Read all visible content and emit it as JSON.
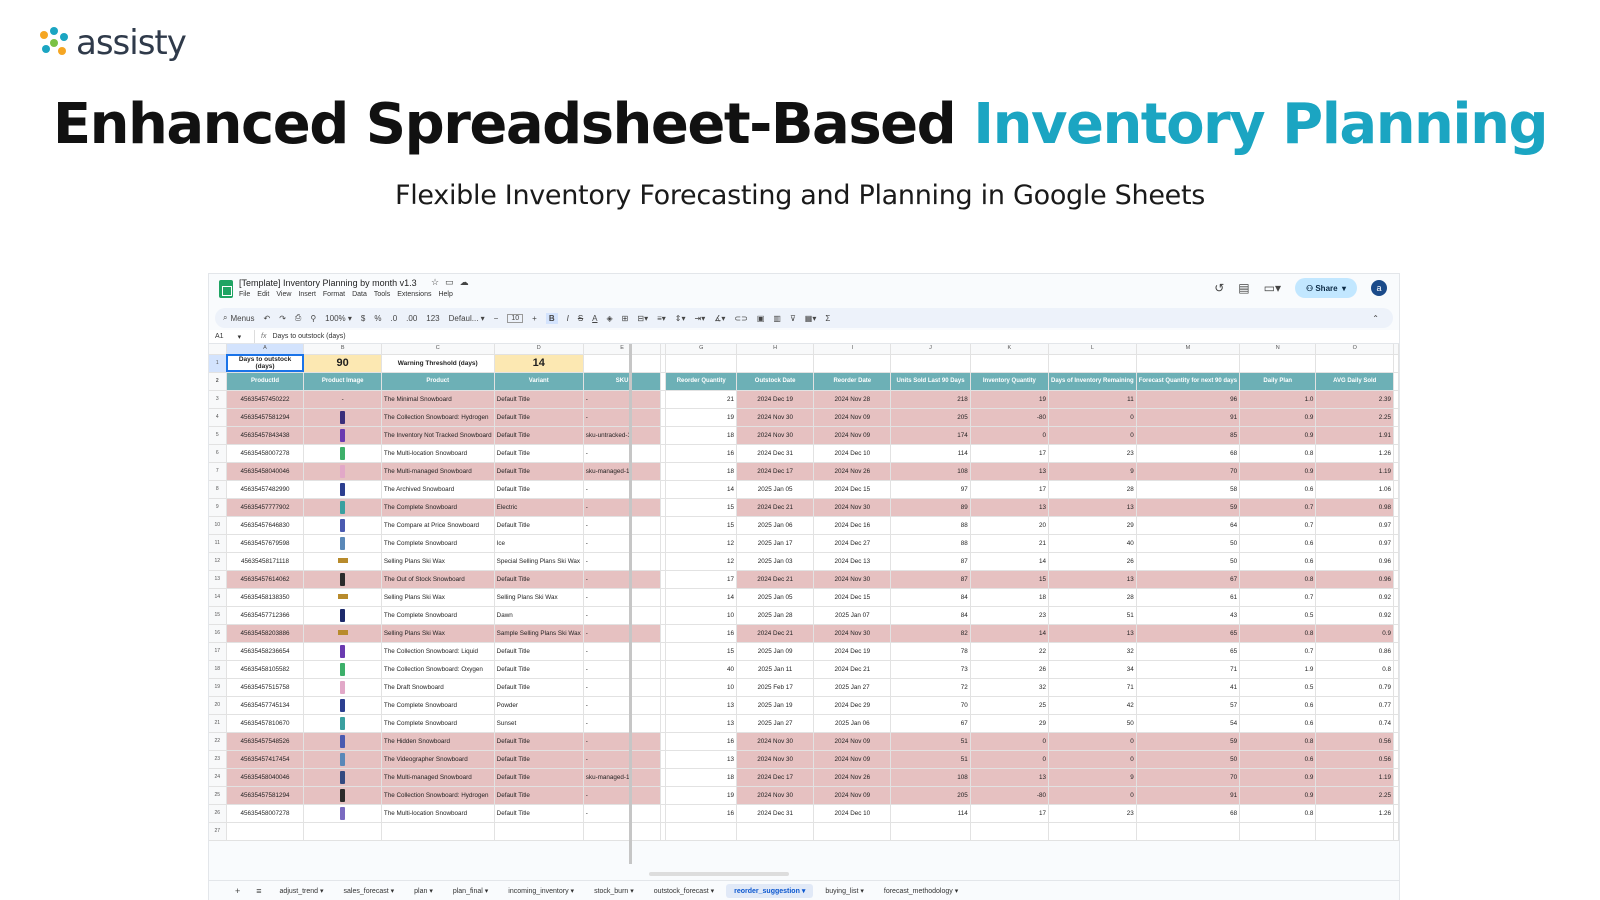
{
  "brand": {
    "name": "assisty"
  },
  "headline": {
    "main": "Enhanced Spreadsheet-Based",
    "accent": "Inventory Planning"
  },
  "subtitle": "Flexible Inventory Forecasting and Planning in Google Sheets",
  "colors": {
    "accent": "#1ba5c2",
    "header_teal": "#6db0b6",
    "pink_row": "#e6c1c1",
    "yellow_cell": "#fce8b2"
  },
  "sheet": {
    "doc_title": "[Template] Inventory Planning by month v1.3",
    "menu": [
      "File",
      "Edit",
      "View",
      "Insert",
      "Format",
      "Data",
      "Tools",
      "Extensions",
      "Help"
    ],
    "share_label": "Share",
    "avatar_letter": "a",
    "toolbar": {
      "menus": "Menus",
      "zoom": "100%",
      "currency": "$",
      "percent": "%",
      "dec_dec": ".0",
      "dec_inc": ".00",
      "format123": "123",
      "font": "Defaul...",
      "size": "10",
      "bold": "B",
      "italic": "I",
      "strike": "S",
      "textcolor": "A"
    },
    "cell_ref": "A1",
    "formula": "Days to outstock (days)",
    "columns": [
      "A",
      "B",
      "C",
      "D",
      "E",
      "G",
      "H",
      "I",
      "J",
      "K",
      "L",
      "M",
      "N",
      "O"
    ],
    "row1": {
      "label1": "Days to outstock (days)",
      "value1": "90",
      "label2": "Warning Threshold (days)",
      "value2": "14"
    },
    "headers": [
      "ProductId",
      "Product Image",
      "Product",
      "Variant",
      "SKU",
      "Reorder Quantity",
      "Outstock Date",
      "Reorder Date",
      "Units Sold Last 90 Days",
      "Inventory Quantity",
      "Days of Inventory Remaining",
      "Forecast Quantity for next 90 days",
      "Daily Plan",
      "AVG Daily Sold"
    ],
    "rows": [
      {
        "n": "3",
        "pink": true,
        "id": "45635457450222",
        "img": "-",
        "product": "The Minimal Snowboard",
        "variant": "Default Title",
        "sku": "-",
        "rq": "21",
        "od": "2024 Dec 19",
        "rd": "2024 Nov 28",
        "us": "218",
        "iq": "19",
        "dr": "11",
        "fq": "96",
        "dp": "1.0",
        "avg": "2.39"
      },
      {
        "n": "4",
        "pink": true,
        "id": "45635457581294",
        "img": "board",
        "product": "The Collection Snowboard: Hydrogen",
        "variant": "Default Title",
        "sku": "-",
        "rq": "19",
        "od": "2024 Nov 30",
        "rd": "2024 Nov 09",
        "us": "205",
        "iq": "-80",
        "dr": "0",
        "fq": "91",
        "dp": "0.9",
        "avg": "2.25"
      },
      {
        "n": "5",
        "pink": true,
        "id": "45635457843438",
        "img": "board",
        "product": "The Inventory Not Tracked Snowboard",
        "variant": "Default Title",
        "sku": "sku-untracked-1",
        "rq": "18",
        "od": "2024 Nov 30",
        "rd": "2024 Nov 09",
        "us": "174",
        "iq": "0",
        "dr": "0",
        "fq": "85",
        "dp": "0.9",
        "avg": "1.91"
      },
      {
        "n": "6",
        "pink": false,
        "id": "45635458007278",
        "img": "board",
        "product": "The Multi-location Snowboard",
        "variant": "Default Title",
        "sku": "-",
        "rq": "16",
        "od": "2024 Dec 31",
        "rd": "2024 Dec 10",
        "us": "114",
        "iq": "17",
        "dr": "23",
        "fq": "68",
        "dp": "0.8",
        "avg": "1.26"
      },
      {
        "n": "7",
        "pink": true,
        "id": "45635458040046",
        "img": "board",
        "product": "The Multi-managed Snowboard",
        "variant": "Default Title",
        "sku": "sku-managed-1",
        "rq": "18",
        "od": "2024 Dec 17",
        "rd": "2024 Nov 26",
        "us": "108",
        "iq": "13",
        "dr": "9",
        "fq": "70",
        "dp": "0.9",
        "avg": "1.19"
      },
      {
        "n": "8",
        "pink": false,
        "id": "45635457482990",
        "img": "board",
        "product": "The Archived Snowboard",
        "variant": "Default Title",
        "sku": "-",
        "rq": "14",
        "od": "2025 Jan 05",
        "rd": "2024 Dec 15",
        "us": "97",
        "iq": "17",
        "dr": "28",
        "fq": "58",
        "dp": "0.6",
        "avg": "1.06"
      },
      {
        "n": "9",
        "pink": true,
        "id": "45635457777902",
        "img": "board",
        "product": "The Complete Snowboard",
        "variant": "Electric",
        "sku": "-",
        "rq": "15",
        "od": "2024 Dec 21",
        "rd": "2024 Nov 30",
        "us": "89",
        "iq": "13",
        "dr": "13",
        "fq": "59",
        "dp": "0.7",
        "avg": "0.98"
      },
      {
        "n": "10",
        "pink": false,
        "id": "45635457646830",
        "img": "board",
        "product": "The Compare at Price Snowboard",
        "variant": "Default Title",
        "sku": "-",
        "rq": "15",
        "od": "2025 Jan 06",
        "rd": "2024 Dec 16",
        "us": "88",
        "iq": "20",
        "dr": "29",
        "fq": "64",
        "dp": "0.7",
        "avg": "0.97"
      },
      {
        "n": "11",
        "pink": false,
        "id": "45635457679598",
        "img": "board",
        "product": "The Complete Snowboard",
        "variant": "Ice",
        "sku": "-",
        "rq": "12",
        "od": "2025 Jan 17",
        "rd": "2024 Dec 27",
        "us": "88",
        "iq": "21",
        "dr": "40",
        "fq": "50",
        "dp": "0.6",
        "avg": "0.97"
      },
      {
        "n": "12",
        "pink": false,
        "id": "45635458171118",
        "img": "wax",
        "product": "Selling Plans Ski Wax",
        "variant": "Special Selling Plans Ski Wax",
        "sku": "-",
        "rq": "12",
        "od": "2025 Jan 03",
        "rd": "2024 Dec 13",
        "us": "87",
        "iq": "14",
        "dr": "26",
        "fq": "50",
        "dp": "0.6",
        "avg": "0.96"
      },
      {
        "n": "13",
        "pink": true,
        "id": "45635457614062",
        "img": "board",
        "product": "The Out of Stock Snowboard",
        "variant": "Default Title",
        "sku": "-",
        "rq": "17",
        "od": "2024 Dec 21",
        "rd": "2024 Nov 30",
        "us": "87",
        "iq": "15",
        "dr": "13",
        "fq": "67",
        "dp": "0.8",
        "avg": "0.96"
      },
      {
        "n": "14",
        "pink": false,
        "id": "45635458138350",
        "img": "wax",
        "product": "Selling Plans Ski Wax",
        "variant": "Selling Plans Ski Wax",
        "sku": "-",
        "rq": "14",
        "od": "2025 Jan 05",
        "rd": "2024 Dec 15",
        "us": "84",
        "iq": "18",
        "dr": "28",
        "fq": "61",
        "dp": "0.7",
        "avg": "0.92"
      },
      {
        "n": "15",
        "pink": false,
        "id": "45635457712366",
        "img": "board",
        "product": "The Complete Snowboard",
        "variant": "Dawn",
        "sku": "-",
        "rq": "10",
        "od": "2025 Jan 28",
        "rd": "2025 Jan 07",
        "us": "84",
        "iq": "23",
        "dr": "51",
        "fq": "43",
        "dp": "0.5",
        "avg": "0.92"
      },
      {
        "n": "16",
        "pink": true,
        "id": "45635458203886",
        "img": "wax",
        "product": "Selling Plans Ski Wax",
        "variant": "Sample Selling Plans Ski Wax",
        "sku": "-",
        "rq": "16",
        "od": "2024 Dec 21",
        "rd": "2024 Nov 30",
        "us": "82",
        "iq": "14",
        "dr": "13",
        "fq": "65",
        "dp": "0.8",
        "avg": "0.9"
      },
      {
        "n": "17",
        "pink": false,
        "id": "45635458236654",
        "img": "board",
        "product": "The Collection Snowboard: Liquid",
        "variant": "Default Title",
        "sku": "-",
        "rq": "15",
        "od": "2025 Jan 09",
        "rd": "2024 Dec 19",
        "us": "78",
        "iq": "22",
        "dr": "32",
        "fq": "65",
        "dp": "0.7",
        "avg": "0.86"
      },
      {
        "n": "18",
        "pink": false,
        "id": "45635458105582",
        "img": "board",
        "product": "The Collection Snowboard: Oxygen",
        "variant": "Default Title",
        "sku": "-",
        "rq": "40",
        "od": "2025 Jan 11",
        "rd": "2024 Dec 21",
        "us": "73",
        "iq": "26",
        "dr": "34",
        "fq": "71",
        "dp": "1.9",
        "avg": "0.8"
      },
      {
        "n": "19",
        "pink": false,
        "id": "45635457515758",
        "img": "board",
        "product": "The Draft Snowboard",
        "variant": "Default Title",
        "sku": "-",
        "rq": "10",
        "od": "2025 Feb 17",
        "rd": "2025 Jan 27",
        "us": "72",
        "iq": "32",
        "dr": "71",
        "fq": "41",
        "dp": "0.5",
        "avg": "0.79"
      },
      {
        "n": "20",
        "pink": false,
        "id": "45635457745134",
        "img": "board",
        "product": "The Complete Snowboard",
        "variant": "Powder",
        "sku": "-",
        "rq": "13",
        "od": "2025 Jan 19",
        "rd": "2024 Dec 29",
        "us": "70",
        "iq": "25",
        "dr": "42",
        "fq": "57",
        "dp": "0.6",
        "avg": "0.77"
      },
      {
        "n": "21",
        "pink": false,
        "id": "45635457810670",
        "img": "board",
        "product": "The Complete Snowboard",
        "variant": "Sunset",
        "sku": "-",
        "rq": "13",
        "od": "2025 Jan 27",
        "rd": "2025 Jan 06",
        "us": "67",
        "iq": "29",
        "dr": "50",
        "fq": "54",
        "dp": "0.6",
        "avg": "0.74"
      },
      {
        "n": "22",
        "pink": true,
        "id": "45635457548526",
        "img": "board",
        "product": "The Hidden Snowboard",
        "variant": "Default Title",
        "sku": "-",
        "rq": "16",
        "od": "2024 Nov 30",
        "rd": "2024 Nov 09",
        "us": "51",
        "iq": "0",
        "dr": "0",
        "fq": "59",
        "dp": "0.8",
        "avg": "0.56"
      },
      {
        "n": "23",
        "pink": true,
        "id": "45635457417454",
        "img": "board",
        "product": "The Videographer Snowboard",
        "variant": "Default Title",
        "sku": "-",
        "rq": "13",
        "od": "2024 Nov 30",
        "rd": "2024 Nov 09",
        "us": "51",
        "iq": "0",
        "dr": "0",
        "fq": "50",
        "dp": "0.6",
        "avg": "0.56"
      },
      {
        "n": "24",
        "pink": true,
        "id": "45635458040046",
        "img": "board",
        "product": "The Multi-managed Snowboard",
        "variant": "Default Title",
        "sku": "sku-managed-1",
        "rq": "18",
        "od": "2024 Dec 17",
        "rd": "2024 Nov 26",
        "us": "108",
        "iq": "13",
        "dr": "9",
        "fq": "70",
        "dp": "0.9",
        "avg": "1.19"
      },
      {
        "n": "25",
        "pink": true,
        "id": "45635457581294",
        "img": "board",
        "product": "The Collection Snowboard: Hydrogen",
        "variant": "Default Title",
        "sku": "-",
        "rq": "19",
        "od": "2024 Nov 30",
        "rd": "2024 Nov 09",
        "us": "205",
        "iq": "-80",
        "dr": "0",
        "fq": "91",
        "dp": "0.9",
        "avg": "2.25"
      },
      {
        "n": "26",
        "pink": false,
        "id": "45635458007278",
        "img": "board",
        "product": "The Multi-location Snowboard",
        "variant": "Default Title",
        "sku": "-",
        "rq": "16",
        "od": "2024 Dec 31",
        "rd": "2024 Dec 10",
        "us": "114",
        "iq": "17",
        "dr": "23",
        "fq": "68",
        "dp": "0.8",
        "avg": "1.26"
      },
      {
        "n": "27",
        "pink": false,
        "empty": true
      }
    ],
    "tabs": [
      "adjust_trend",
      "sales_forecast",
      "plan",
      "plan_final",
      "incoming_inventory",
      "stock_burn",
      "outstock_forecast",
      "reorder_suggestion",
      "buying_list",
      "forecast_methodology"
    ],
    "active_tab": "reorder_suggestion"
  }
}
